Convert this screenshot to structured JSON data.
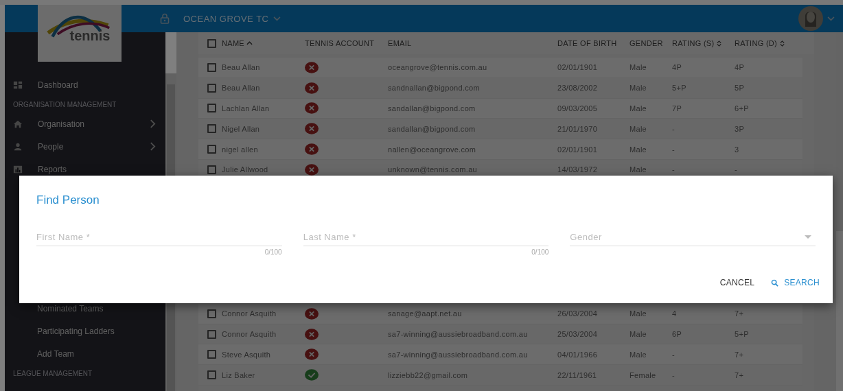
{
  "header": {
    "logo_text": "tennis",
    "organisation": "OCEAN GROVE TC"
  },
  "sidebar": {
    "top_items": [
      {
        "kind": "item",
        "label": "Dashboard",
        "has_submenu": false
      },
      {
        "kind": "section",
        "label": "ORGANISATION MANAGEMENT"
      },
      {
        "kind": "item",
        "label": "Organisation",
        "has_submenu": true
      },
      {
        "kind": "item",
        "label": "People",
        "has_submenu": true
      },
      {
        "kind": "item",
        "label": "Reports",
        "has_submenu": false
      }
    ],
    "bottom_items": [
      {
        "kind": "subitem",
        "label": "Nominated Teams"
      },
      {
        "kind": "subitem",
        "label": "Participating Ladders"
      },
      {
        "kind": "subitem",
        "label": "Add Team"
      },
      {
        "kind": "section",
        "label": "LEAGUE MANAGEMENT"
      }
    ]
  },
  "table": {
    "all_checked": false,
    "columns": [
      {
        "kind": "sorted",
        "label": "NAME"
      },
      {
        "kind": "plain",
        "label": "TENNIS ACCOUNT"
      },
      {
        "kind": "plain",
        "label": "EMAIL"
      },
      {
        "kind": "plain",
        "label": "DATE OF BIRTH"
      },
      {
        "kind": "plain",
        "label": "GENDER"
      },
      {
        "kind": "sortable",
        "label": "RATING (S)"
      },
      {
        "kind": "sortable",
        "label": "RATING (D)"
      }
    ],
    "rows_top": [
      {
        "checked": false,
        "name": "Beau Allan",
        "account": false,
        "email": "oceangrove@tennis.com.au",
        "dob": "02/01/1901",
        "gender": "Male",
        "rating_s": "4P",
        "rating_d": "4P"
      },
      {
        "checked": false,
        "name": "Beau Allan",
        "account": false,
        "email": "sandnallan@bigpond.com",
        "dob": "23/08/2002",
        "gender": "Male",
        "rating_s": "5+P",
        "rating_d": "5P"
      },
      {
        "checked": false,
        "name": "Lachlan Allan",
        "account": false,
        "email": "sandallan@bigpond.com",
        "dob": "09/03/2005",
        "gender": "Male",
        "rating_s": "7P",
        "rating_d": "6+P"
      },
      {
        "checked": false,
        "name": "Nigel Allan",
        "account": false,
        "email": "sandallan@bigpond.com",
        "dob": "21/01/1970",
        "gender": "Male",
        "rating_s": "-",
        "rating_d": "3P"
      },
      {
        "checked": false,
        "name": "nigel allen",
        "account": false,
        "email": "nallen@oceangrove.com",
        "dob": "02/01/1901",
        "gender": "Male",
        "rating_s": "-",
        "rating_d": "3"
      },
      {
        "checked": false,
        "name": "Julie Allwood",
        "account": false,
        "email": "unknown@tennis.com.au",
        "dob": "14/03/1972",
        "gender": "Male",
        "rating_s": "-",
        "rating_d": "-"
      }
    ],
    "rows_bottom": [
      {
        "checked": false,
        "name": "Connor Asquith",
        "account": false,
        "email": "sanage@aapt.net.au",
        "dob": "26/03/2004",
        "gender": "Male",
        "rating_s": "4",
        "rating_d": "7+"
      },
      {
        "checked": false,
        "name": "Connor Asquith",
        "account": false,
        "email": "sa7-winning@aussiebroadband.com.au",
        "dob": "25/03/2004",
        "gender": "Male",
        "rating_s": "6P",
        "rating_d": "5+P"
      },
      {
        "checked": false,
        "name": "Steve Asquith",
        "account": false,
        "email": "sa7-winning@aussiebroadband.com.au",
        "dob": "04/01/1966",
        "gender": "Male",
        "rating_s": "-",
        "rating_d": "7+"
      },
      {
        "checked": false,
        "name": "Liz Baker",
        "account": true,
        "email": "lizziebb22@gmail.com",
        "dob": "22/11/1961",
        "gender": "Female",
        "rating_s": "-",
        "rating_d": "7+"
      }
    ]
  },
  "dialog": {
    "title": "Find Person",
    "fields": [
      {
        "kind": "text",
        "placeholder": "First Name *",
        "counter": "0/100"
      },
      {
        "kind": "text",
        "placeholder": "Last Name *",
        "counter": "0/100"
      },
      {
        "kind": "select",
        "placeholder": "Gender"
      }
    ],
    "buttons": [
      {
        "kind": "cancel",
        "label": "CANCEL"
      },
      {
        "kind": "search",
        "label": "SEARCH"
      }
    ]
  }
}
